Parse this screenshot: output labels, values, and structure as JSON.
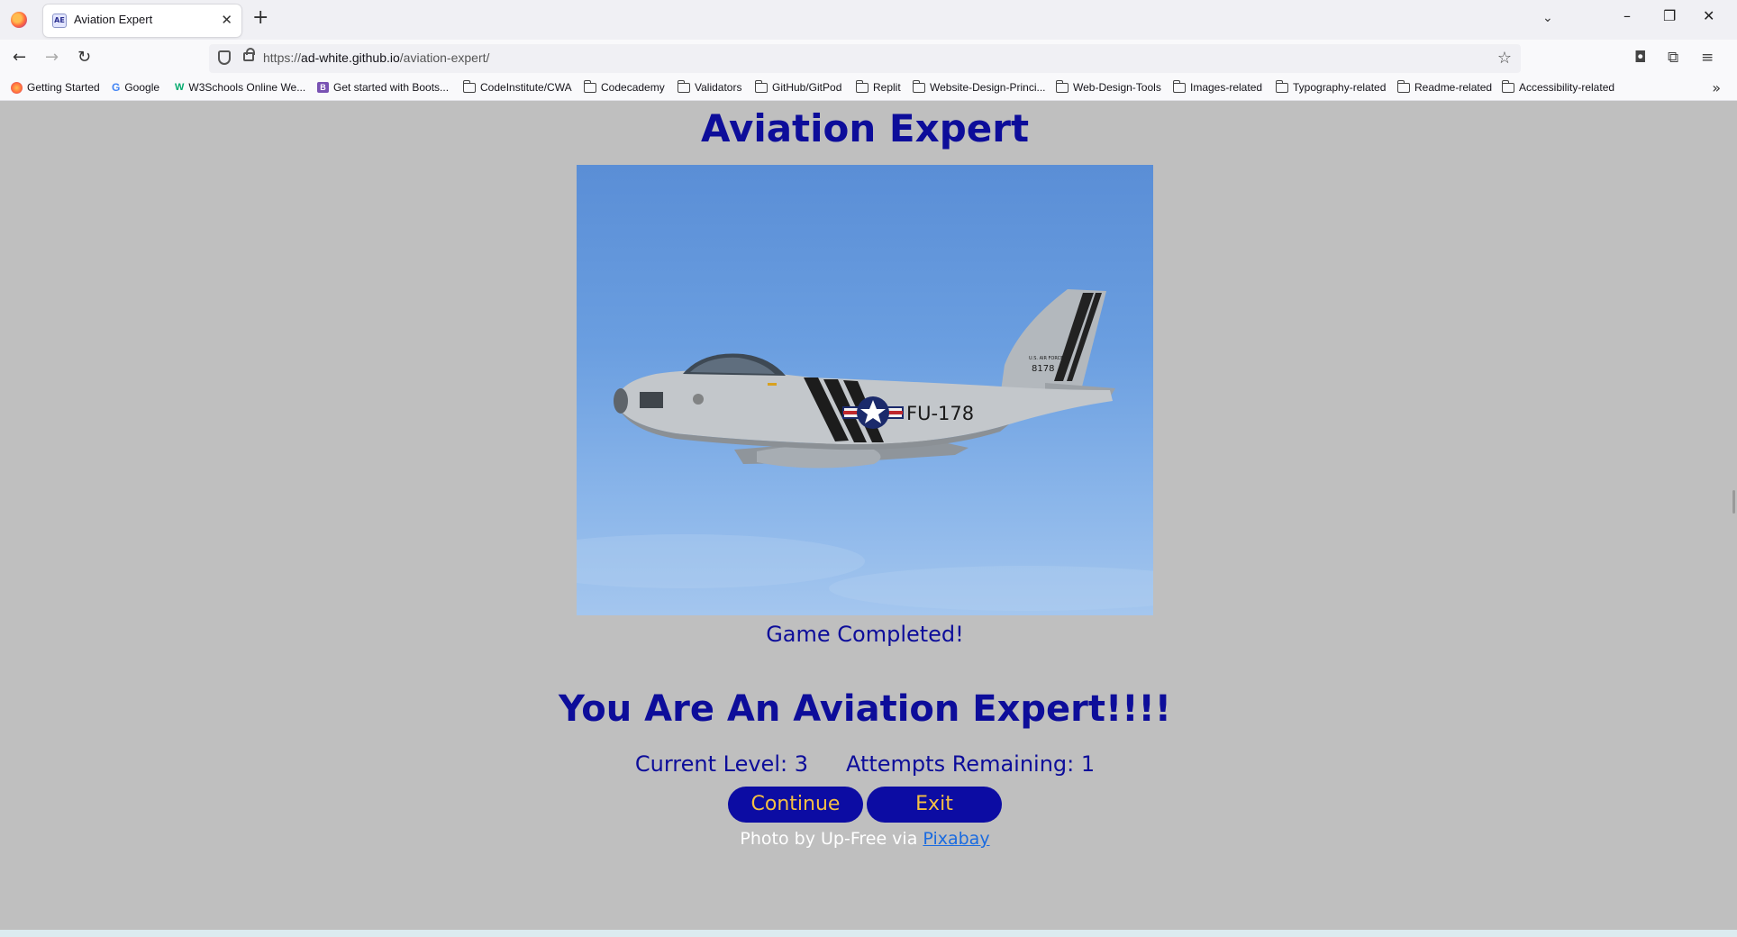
{
  "browser": {
    "tab_title": "Aviation Expert",
    "tab_favicon_text": "AE",
    "url_prefix": "https://",
    "url_host": "ad-white.github.io",
    "url_path": "/aviation-expert/",
    "bookmarks": [
      "Getting Started",
      "Google",
      "W3Schools Online We...",
      "Get started with Boots...",
      "CodeInstitute/CWA",
      "Codecademy",
      "Validators",
      "GitHub/GitPod",
      "Replit",
      "Website-Design-Princi...",
      "Web-Design-Tools",
      "Images-related",
      "Typography-related",
      "Readme-related",
      "Accessibility-related"
    ]
  },
  "page": {
    "title": "Aviation Expert",
    "status": "Game Completed!",
    "message": "You Are An Aviation Expert!!!!",
    "current_level": "Current Level: 3",
    "attempts_remaining": "Attempts Remaining: 1",
    "continue_label": "Continue",
    "exit_label": "Exit",
    "credit_prefix": "Photo by Up-Free via ",
    "credit_link": "Pixabay",
    "plane_markings": {
      "tail_code": "FU-178",
      "tail_number": "8178",
      "tail_text": "U.S. AIR FORCE"
    }
  },
  "colors": {
    "page_background": "#bfbfbf",
    "heading_text": "#0d0d9a",
    "button_background": "#0c0ca3",
    "button_text": "#f5c043",
    "link": "#1a6be0"
  }
}
